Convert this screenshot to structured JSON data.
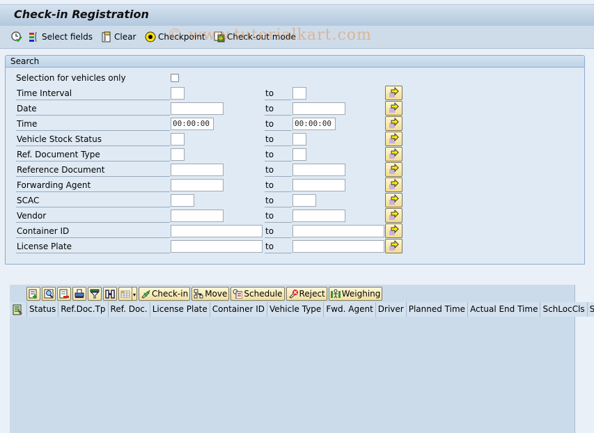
{
  "window": {
    "title": "Check-in Registration"
  },
  "toolbar": {
    "items": [
      {
        "icon": "execute-clock-icon",
        "label": ""
      },
      {
        "icon": "select-fields-icon",
        "label": "Select fields"
      },
      {
        "icon": "clear-icon",
        "label": "Clear"
      },
      {
        "icon": "checkpoint-radio-icon",
        "label": "Checkpoint"
      },
      {
        "icon": "check-out-mode-icon",
        "label": "Check-out mode"
      }
    ]
  },
  "watermark": "© www.tutorialkart.com",
  "search": {
    "title": "Search",
    "selection_vehicles_only": {
      "label": "Selection for vehicles only",
      "checked": false
    },
    "to_label": "to",
    "rows": [
      {
        "label": "Time Interval",
        "from": "",
        "to": ""
      },
      {
        "label": "Date",
        "from": "",
        "to": ""
      },
      {
        "label": "Time",
        "from": "00:00:00",
        "to": "00:00:00"
      },
      {
        "label": "Vehicle Stock Status",
        "from": "",
        "to": ""
      },
      {
        "label": "Ref. Document Type",
        "from": "",
        "to": ""
      },
      {
        "label": "Reference Document",
        "from": "",
        "to": ""
      },
      {
        "label": "Forwarding Agent",
        "from": "",
        "to": ""
      },
      {
        "label": "SCAC",
        "from": "",
        "to": ""
      },
      {
        "label": "Vendor",
        "from": "",
        "to": ""
      },
      {
        "label": "Container ID",
        "from": "",
        "to": ""
      },
      {
        "label": "License Plate",
        "from": "",
        "to": ""
      }
    ]
  },
  "grid": {
    "toolbar": {
      "icon_buttons": [
        "details-icon",
        "find-icon",
        "delete-icon",
        "print-icon",
        "filter-icon",
        "binoculars-icon",
        "layout-icon"
      ],
      "text_buttons": [
        {
          "icon": "check-in-icon",
          "label": "Check-in"
        },
        {
          "icon": "move-icon",
          "label": "Move"
        },
        {
          "icon": "schedule-icon",
          "label": "Schedule"
        },
        {
          "icon": "reject-icon",
          "label": "Reject"
        },
        {
          "icon": "weighing-icon",
          "label": "Weighing"
        }
      ]
    },
    "columns": [
      "Status",
      "Ref.Doc.Tp",
      "Ref. Doc.",
      "License Plate",
      "Container ID",
      "Vehicle Type",
      "Fwd. Agent",
      "Driver",
      "Planned Time",
      "Actual End Time",
      "SchLocCls",
      "Sc"
    ],
    "rows": []
  }
}
